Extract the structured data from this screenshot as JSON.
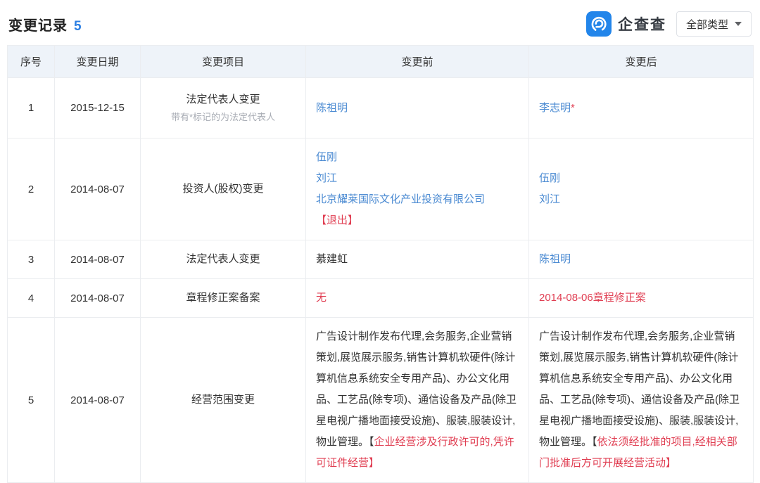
{
  "header": {
    "title": "变更记录",
    "count": "5",
    "brand_name": "企查查",
    "filter_label": "全部类型"
  },
  "colors": {
    "link_blue": "#4a8ad2",
    "alert_red": "#e03e52",
    "accent_blue": "#2b7fe3",
    "header_band": "#eef3f9",
    "logo_blue": "#2285ea"
  },
  "table": {
    "headers": [
      "序号",
      "变更日期",
      "变更项目",
      "变更前",
      "变更后"
    ],
    "rows": [
      {
        "no": "1",
        "date": "2015-12-15",
        "item": "法定代表人变更",
        "note": "带有*标记的为法定代表人",
        "before": [
          [
            {
              "t": "陈祖明",
              "c": "link"
            }
          ]
        ],
        "after": [
          [
            {
              "t": "李志明",
              "c": "link"
            },
            {
              "t": "*",
              "c": "red"
            }
          ]
        ]
      },
      {
        "no": "2",
        "date": "2014-08-07",
        "item": "投资人(股权)变更",
        "note": "",
        "before": [
          [
            {
              "t": "伍刚",
              "c": "link"
            }
          ],
          [
            {
              "t": "刘江",
              "c": "link"
            }
          ],
          [
            {
              "t": "北京耀莱国际文化产业投资有限公司",
              "c": "link"
            }
          ],
          [
            {
              "t": "【退出】",
              "c": "red"
            }
          ]
        ],
        "after": [
          [
            {
              "t": "伍刚",
              "c": "link"
            }
          ],
          [
            {
              "t": "刘江",
              "c": "link"
            }
          ]
        ]
      },
      {
        "no": "3",
        "date": "2014-08-07",
        "item": "法定代表人变更",
        "note": "",
        "before": [
          [
            {
              "t": "綦建虹",
              "c": "text"
            }
          ]
        ],
        "after": [
          [
            {
              "t": "陈祖明",
              "c": "link"
            }
          ]
        ]
      },
      {
        "no": "4",
        "date": "2014-08-07",
        "item": "章程修正案备案",
        "note": "",
        "before": [
          [
            {
              "t": "无",
              "c": "red"
            }
          ]
        ],
        "after": [
          [
            {
              "t": "2014-08-06章程修正案",
              "c": "red"
            }
          ]
        ]
      },
      {
        "no": "5",
        "date": "2014-08-07",
        "item": "经营范围变更",
        "note": "",
        "before": [
          [
            {
              "t": "广告设计制作发布代理,会务服务,企业营销策划,展览展示服务,销售计算机软硬件(除计算机信息系统安全专用产品)、办公文化用品、工艺品(除专项)、通信设备及产品(除卫星电视广播地面接受设施)、服装,服装设计,物业管理。",
              "c": "text"
            },
            {
              "t": "【",
              "c": "text"
            },
            {
              "t": "企业经营涉及行政许可的,凭许可证件经营】",
              "c": "red"
            }
          ]
        ],
        "after": [
          [
            {
              "t": "广告设计制作发布代理,会务服务,企业营销策划,展览展示服务,销售计算机软硬件(除计算机信息系统安全专用产品)、办公文化用品、工艺品(除专项)、通信设备及产品(除卫星电视广播地面接受设施)、服装,服装设计,物业管理。",
              "c": "text"
            },
            {
              "t": "【",
              "c": "text"
            },
            {
              "t": "依法须经批准的项目,经相关部门批准后方可开展经营活动】",
              "c": "red"
            }
          ]
        ]
      }
    ]
  }
}
